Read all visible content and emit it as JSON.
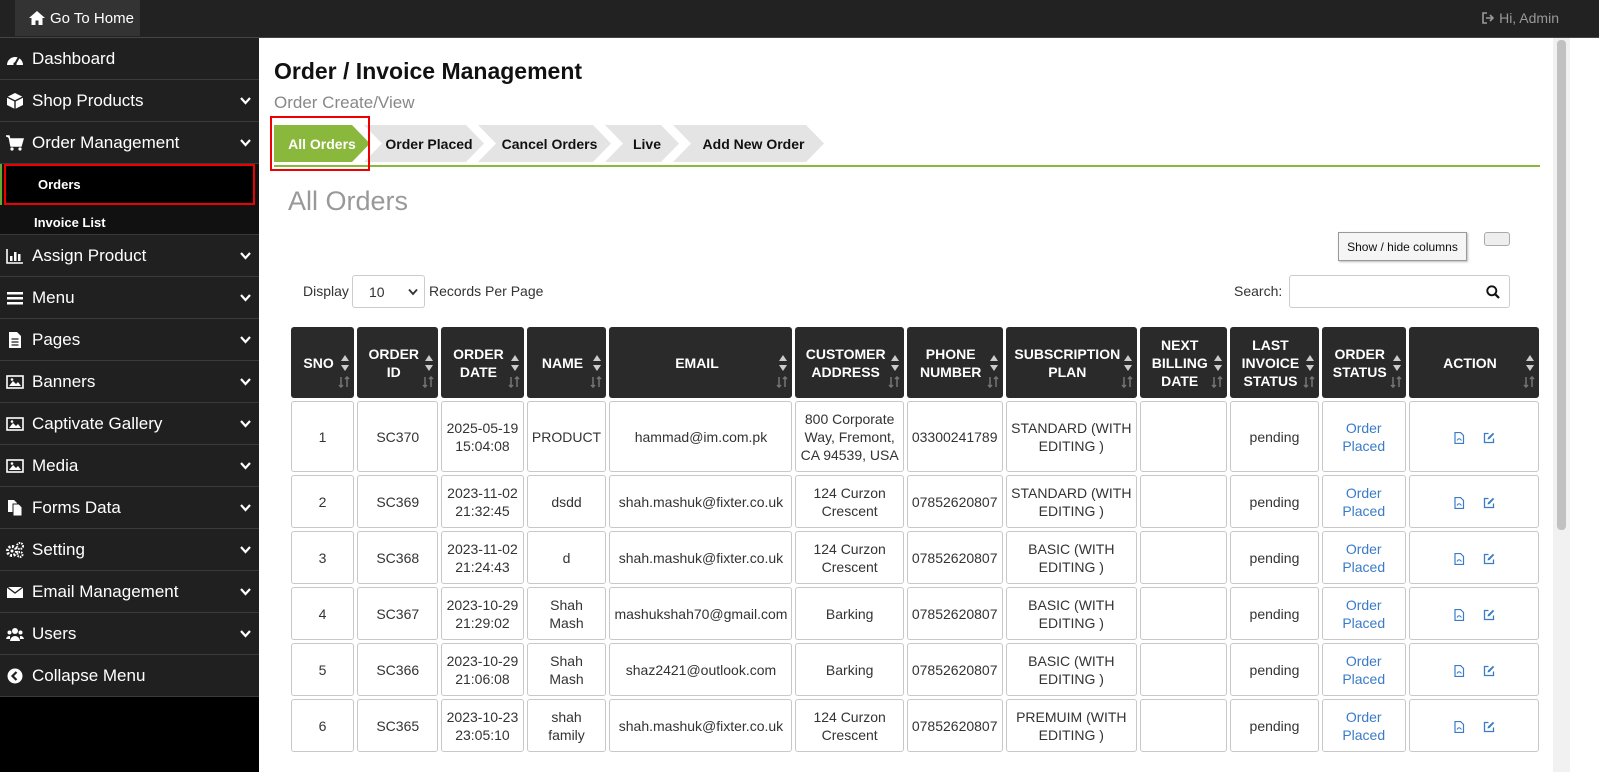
{
  "topbar": {
    "home_label": "Go To Home",
    "user_label": "Hi, Admin"
  },
  "sidebar": {
    "items": [
      {
        "label": "Dashboard",
        "icon": "dashboard-icon"
      },
      {
        "label": "Shop Products",
        "icon": "box-icon"
      },
      {
        "label": "Order Management",
        "icon": "cart-icon"
      },
      {
        "label": "Assign Product",
        "icon": "bar-chart-icon"
      },
      {
        "label": "Menu",
        "icon": "bars-icon"
      },
      {
        "label": "Pages",
        "icon": "file-icon"
      },
      {
        "label": "Banners",
        "icon": "image-icon"
      },
      {
        "label": "Captivate Gallery",
        "icon": "image-icon"
      },
      {
        "label": "Media",
        "icon": "image-icon"
      },
      {
        "label": "Forms Data",
        "icon": "files-icon"
      },
      {
        "label": "Setting",
        "icon": "gears-icon"
      },
      {
        "label": "Email Management",
        "icon": "envelope-icon"
      },
      {
        "label": "Users",
        "icon": "users-icon"
      },
      {
        "label": "Collapse Menu",
        "icon": "chevron-left-circle-icon"
      }
    ],
    "sub_items": [
      "Orders",
      "Invoice List"
    ]
  },
  "page": {
    "title": "Order / Invoice Management",
    "subtitle": "Order Create/View",
    "tabs": [
      "All Orders",
      "Order Placed",
      "Cancel Orders",
      "Live",
      "Add New Order"
    ],
    "section_title": "All Orders",
    "show_hide_label": "Show / hide columns",
    "display_label": "Display",
    "records_value": "10",
    "records_label": "Records Per Page",
    "search_label": "Search:",
    "search_value": ""
  },
  "table": {
    "headers": [
      "SNO",
      "ORDER ID",
      "ORDER DATE",
      "NAME",
      "EMAIL",
      "CUSTOMER ADDRESS",
      "PHONE NUMBER",
      "SUBSCRIPTION PLAN",
      "NEXT BILLING DATE",
      "LAST INVOICE STATUS",
      "ORDER STATUS",
      "ACTION"
    ],
    "rows": [
      [
        "1",
        "SC370",
        "2025-05-19 15:04:08",
        "PRODUCT",
        "hammad@im.com.pk",
        "800 Corporate Way, Fremont, CA 94539, USA",
        "03300241789",
        "STANDARD (WITH EDITING )",
        "",
        "pending",
        "Order Placed"
      ],
      [
        "2",
        "SC369",
        "2023-11-02 21:32:45",
        "dsdd",
        "shah.mashuk@fixter.co.uk",
        "124 Curzon Crescent",
        "07852620807",
        "STANDARD (WITH EDITING )",
        "",
        "pending",
        "Order Placed"
      ],
      [
        "3",
        "SC368",
        "2023-11-02 21:24:43",
        "d",
        "shah.mashuk@fixter.co.uk",
        "124 Curzon Crescent",
        "07852620807",
        "BASIC (WITH EDITING )",
        "",
        "pending",
        "Order Placed"
      ],
      [
        "4",
        "SC367",
        "2023-10-29 21:29:02",
        "Shah Mash",
        "mashukshah70@gmail.com",
        "Barking",
        "07852620807",
        "BASIC (WITH EDITING )",
        "",
        "pending",
        "Order Placed"
      ],
      [
        "5",
        "SC366",
        "2023-10-29 21:06:08",
        "Shah Mash",
        "shaz2421@outlook.com",
        "Barking",
        "07852620807",
        "BASIC (WITH EDITING )",
        "",
        "pending",
        "Order Placed"
      ],
      [
        "6",
        "SC365",
        "2023-10-23 23:05:10",
        "shah family",
        "shah.mashuk@fixter.co.uk",
        "124 Curzon Crescent",
        "07852620807",
        "PREMUIM (WITH EDITING )",
        "",
        "pending",
        "Order Placed"
      ]
    ]
  },
  "colors": {
    "accent_green": "#8ab83d",
    "link_blue": "#3a7bc8",
    "highlight_red": "#e00000"
  }
}
